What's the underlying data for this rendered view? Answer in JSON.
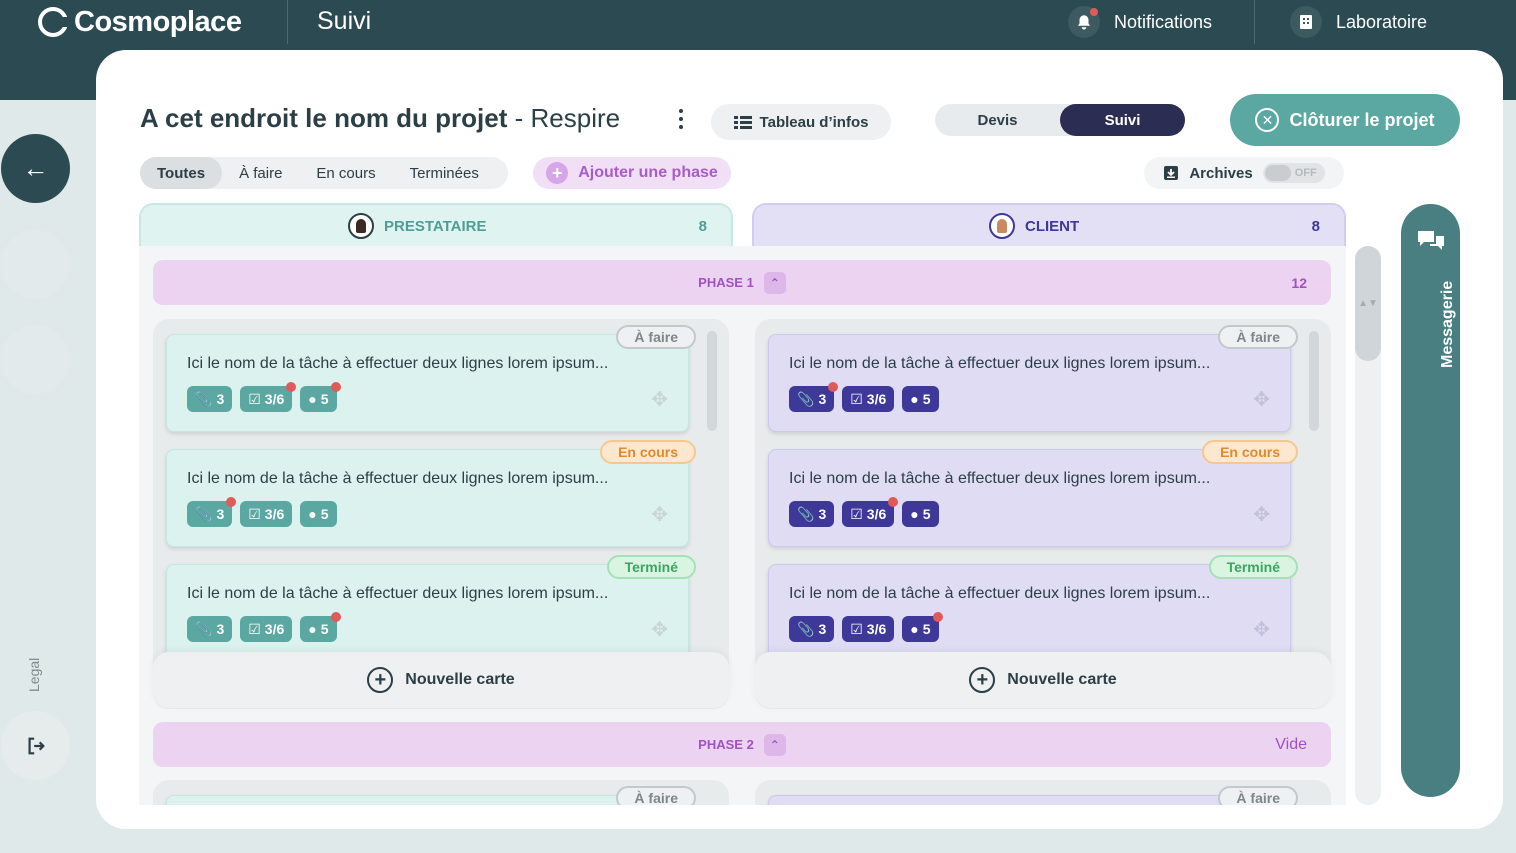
{
  "app": {
    "name": "Cosmoplace",
    "page": "Suivi"
  },
  "header": {
    "notifications_label": "Notifications",
    "lab_label": "Laboratoire"
  },
  "sidebar": {
    "legal": "Legal"
  },
  "project": {
    "name": "A cet endroit le nom du projet",
    "separator": "-",
    "client": "Respire"
  },
  "toolbar": {
    "infos_label": "Tableau d’infos",
    "tabs": [
      "Devis",
      "Suivi"
    ],
    "active_tab": "Suivi",
    "close_label": "Clôturer le projet"
  },
  "filters": {
    "items": [
      "Toutes",
      "À faire",
      "En cours",
      "Terminées"
    ],
    "active": "Toutes",
    "add_phase": "Ajouter une phase"
  },
  "archives": {
    "label": "Archives",
    "toggle": "OFF"
  },
  "columns": [
    {
      "title": "PRESTATAIRE",
      "count": "8"
    },
    {
      "title": "CLIENT",
      "count": "8"
    }
  ],
  "phases": [
    {
      "title": "PHASE 1",
      "count": "12"
    },
    {
      "title": "PHASE 2",
      "count": "Vide"
    }
  ],
  "task_title": "Ici le nom de la tâche à effectuer deux lignes lorem ipsum...",
  "statuses": [
    "À faire",
    "En cours",
    "Terminé"
  ],
  "chips": {
    "attachments": "3",
    "checklist": "3/6",
    "comments": "5"
  },
  "new_card": "Nouvelle carte",
  "messagerie": "Messagerie",
  "colors": {
    "teal": "#5aa8a1",
    "indigo": "#3e3899",
    "dark": "#2c4a52",
    "phase": "#ecd3f2",
    "alert": "#e05a5a"
  }
}
